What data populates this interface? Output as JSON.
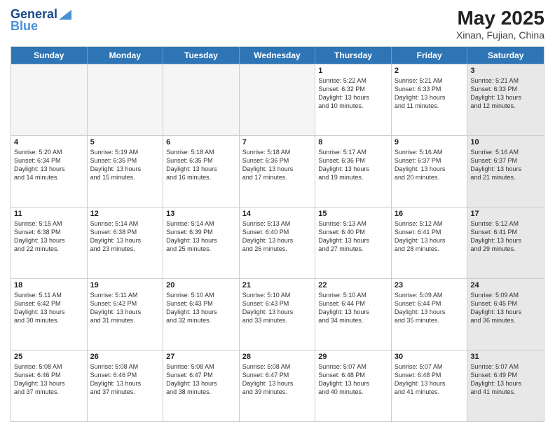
{
  "header": {
    "logo_line1": "General",
    "logo_line2": "Blue",
    "title": "May 2025",
    "subtitle": "Xinan, Fujian, China"
  },
  "days_of_week": [
    "Sunday",
    "Monday",
    "Tuesday",
    "Wednesday",
    "Thursday",
    "Friday",
    "Saturday"
  ],
  "weeks": [
    [
      {
        "day": "",
        "info": "",
        "empty": true
      },
      {
        "day": "",
        "info": "",
        "empty": true
      },
      {
        "day": "",
        "info": "",
        "empty": true
      },
      {
        "day": "",
        "info": "",
        "empty": true
      },
      {
        "day": "1",
        "info": "Sunrise: 5:22 AM\nSunset: 6:32 PM\nDaylight: 13 hours\nand 10 minutes."
      },
      {
        "day": "2",
        "info": "Sunrise: 5:21 AM\nSunset: 6:33 PM\nDaylight: 13 hours\nand 11 minutes."
      },
      {
        "day": "3",
        "info": "Sunrise: 5:21 AM\nSunset: 6:33 PM\nDaylight: 13 hours\nand 12 minutes.",
        "shaded": true
      }
    ],
    [
      {
        "day": "4",
        "info": "Sunrise: 5:20 AM\nSunset: 6:34 PM\nDaylight: 13 hours\nand 14 minutes."
      },
      {
        "day": "5",
        "info": "Sunrise: 5:19 AM\nSunset: 6:35 PM\nDaylight: 13 hours\nand 15 minutes."
      },
      {
        "day": "6",
        "info": "Sunrise: 5:18 AM\nSunset: 6:35 PM\nDaylight: 13 hours\nand 16 minutes."
      },
      {
        "day": "7",
        "info": "Sunrise: 5:18 AM\nSunset: 6:36 PM\nDaylight: 13 hours\nand 17 minutes."
      },
      {
        "day": "8",
        "info": "Sunrise: 5:17 AM\nSunset: 6:36 PM\nDaylight: 13 hours\nand 19 minutes."
      },
      {
        "day": "9",
        "info": "Sunrise: 5:16 AM\nSunset: 6:37 PM\nDaylight: 13 hours\nand 20 minutes."
      },
      {
        "day": "10",
        "info": "Sunrise: 5:16 AM\nSunset: 6:37 PM\nDaylight: 13 hours\nand 21 minutes.",
        "shaded": true
      }
    ],
    [
      {
        "day": "11",
        "info": "Sunrise: 5:15 AM\nSunset: 6:38 PM\nDaylight: 13 hours\nand 22 minutes."
      },
      {
        "day": "12",
        "info": "Sunrise: 5:14 AM\nSunset: 6:38 PM\nDaylight: 13 hours\nand 23 minutes."
      },
      {
        "day": "13",
        "info": "Sunrise: 5:14 AM\nSunset: 6:39 PM\nDaylight: 13 hours\nand 25 minutes."
      },
      {
        "day": "14",
        "info": "Sunrise: 5:13 AM\nSunset: 6:40 PM\nDaylight: 13 hours\nand 26 minutes."
      },
      {
        "day": "15",
        "info": "Sunrise: 5:13 AM\nSunset: 6:40 PM\nDaylight: 13 hours\nand 27 minutes."
      },
      {
        "day": "16",
        "info": "Sunrise: 5:12 AM\nSunset: 6:41 PM\nDaylight: 13 hours\nand 28 minutes."
      },
      {
        "day": "17",
        "info": "Sunrise: 5:12 AM\nSunset: 6:41 PM\nDaylight: 13 hours\nand 29 minutes.",
        "shaded": true
      }
    ],
    [
      {
        "day": "18",
        "info": "Sunrise: 5:11 AM\nSunset: 6:42 PM\nDaylight: 13 hours\nand 30 minutes."
      },
      {
        "day": "19",
        "info": "Sunrise: 5:11 AM\nSunset: 6:42 PM\nDaylight: 13 hours\nand 31 minutes."
      },
      {
        "day": "20",
        "info": "Sunrise: 5:10 AM\nSunset: 6:43 PM\nDaylight: 13 hours\nand 32 minutes."
      },
      {
        "day": "21",
        "info": "Sunrise: 5:10 AM\nSunset: 6:43 PM\nDaylight: 13 hours\nand 33 minutes."
      },
      {
        "day": "22",
        "info": "Sunrise: 5:10 AM\nSunset: 6:44 PM\nDaylight: 13 hours\nand 34 minutes."
      },
      {
        "day": "23",
        "info": "Sunrise: 5:09 AM\nSunset: 6:44 PM\nDaylight: 13 hours\nand 35 minutes."
      },
      {
        "day": "24",
        "info": "Sunrise: 5:09 AM\nSunset: 6:45 PM\nDaylight: 13 hours\nand 36 minutes.",
        "shaded": true
      }
    ],
    [
      {
        "day": "25",
        "info": "Sunrise: 5:08 AM\nSunset: 6:46 PM\nDaylight: 13 hours\nand 37 minutes."
      },
      {
        "day": "26",
        "info": "Sunrise: 5:08 AM\nSunset: 6:46 PM\nDaylight: 13 hours\nand 37 minutes."
      },
      {
        "day": "27",
        "info": "Sunrise: 5:08 AM\nSunset: 6:47 PM\nDaylight: 13 hours\nand 38 minutes."
      },
      {
        "day": "28",
        "info": "Sunrise: 5:08 AM\nSunset: 6:47 PM\nDaylight: 13 hours\nand 39 minutes."
      },
      {
        "day": "29",
        "info": "Sunrise: 5:07 AM\nSunset: 6:48 PM\nDaylight: 13 hours\nand 40 minutes."
      },
      {
        "day": "30",
        "info": "Sunrise: 5:07 AM\nSunset: 6:48 PM\nDaylight: 13 hours\nand 41 minutes."
      },
      {
        "day": "31",
        "info": "Sunrise: 5:07 AM\nSunset: 6:49 PM\nDaylight: 13 hours\nand 41 minutes.",
        "shaded": true
      }
    ]
  ]
}
